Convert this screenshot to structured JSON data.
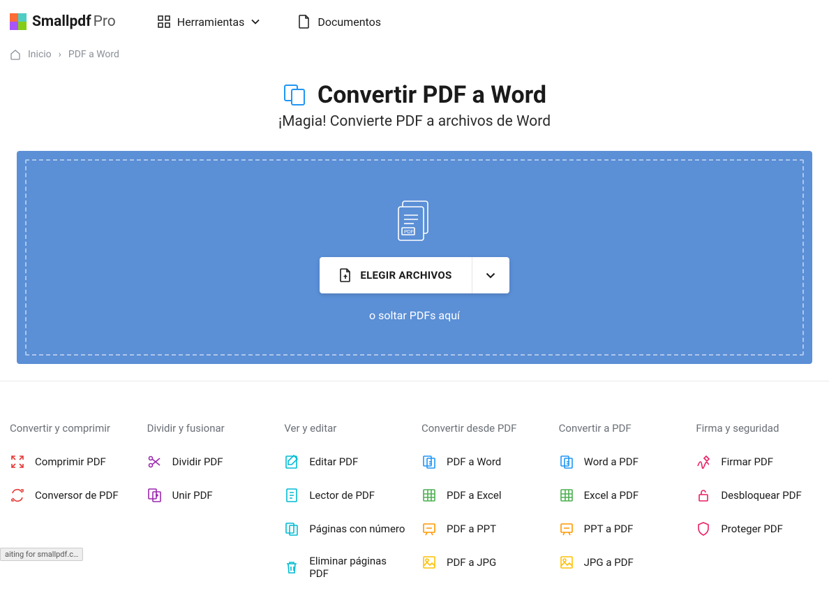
{
  "logo": {
    "name": "Smallpdf",
    "suffix": "Pro"
  },
  "nav": {
    "tools": "Herramientas",
    "documents": "Documentos"
  },
  "breadcrumb": {
    "home": "Inicio",
    "sep": "›",
    "current": "PDF a Word"
  },
  "hero": {
    "title": "Convertir PDF a Word",
    "subtitle": "¡Magia! Convierte PDF a archivos de Word"
  },
  "dropzone": {
    "button": "ELEGIR ARCHIVOS",
    "hint": "o soltar PDFs aquí"
  },
  "columns": [
    {
      "title": "Convertir y comprimir",
      "tools": [
        {
          "label": "Comprimir PDF",
          "color": "#e53935",
          "icon": "compress"
        },
        {
          "label": "Conversor de PDF",
          "color": "#e53935",
          "icon": "convert"
        }
      ]
    },
    {
      "title": "Dividir y fusionar",
      "tools": [
        {
          "label": "Dividir PDF",
          "color": "#9c27b0",
          "icon": "split"
        },
        {
          "label": "Unir PDF",
          "color": "#9c27b0",
          "icon": "merge"
        }
      ]
    },
    {
      "title": "Ver y editar",
      "tools": [
        {
          "label": "Editar PDF",
          "color": "#00bcd4",
          "icon": "edit"
        },
        {
          "label": "Lector de PDF",
          "color": "#00bcd4",
          "icon": "reader"
        },
        {
          "label": "Páginas con número",
          "color": "#00bcd4",
          "icon": "pages"
        },
        {
          "label": "Eliminar páginas PDF",
          "color": "#00bcd4",
          "icon": "delete"
        }
      ]
    },
    {
      "title": "Convertir desde PDF",
      "tools": [
        {
          "label": "PDF a Word",
          "color": "#2196f3",
          "icon": "doc"
        },
        {
          "label": "PDF a Excel",
          "color": "#4caf50",
          "icon": "xls"
        },
        {
          "label": "PDF a PPT",
          "color": "#ff9800",
          "icon": "ppt"
        },
        {
          "label": "PDF a JPG",
          "color": "#ffc107",
          "icon": "jpg"
        }
      ]
    },
    {
      "title": "Convertir a PDF",
      "tools": [
        {
          "label": "Word a PDF",
          "color": "#2196f3",
          "icon": "doc"
        },
        {
          "label": "Excel a PDF",
          "color": "#4caf50",
          "icon": "xls"
        },
        {
          "label": "PPT a PDF",
          "color": "#ff9800",
          "icon": "ppt"
        },
        {
          "label": "JPG a PDF",
          "color": "#ffc107",
          "icon": "jpg"
        }
      ]
    },
    {
      "title": "Firma y seguridad",
      "tools": [
        {
          "label": "Firmar PDF",
          "color": "#e91e63",
          "icon": "sign"
        },
        {
          "label": "Desbloquear PDF",
          "color": "#e91e63",
          "icon": "unlock"
        },
        {
          "label": "Proteger PDF",
          "color": "#e91e63",
          "icon": "protect"
        }
      ]
    }
  ],
  "status": "aiting for smallpdf.c…"
}
